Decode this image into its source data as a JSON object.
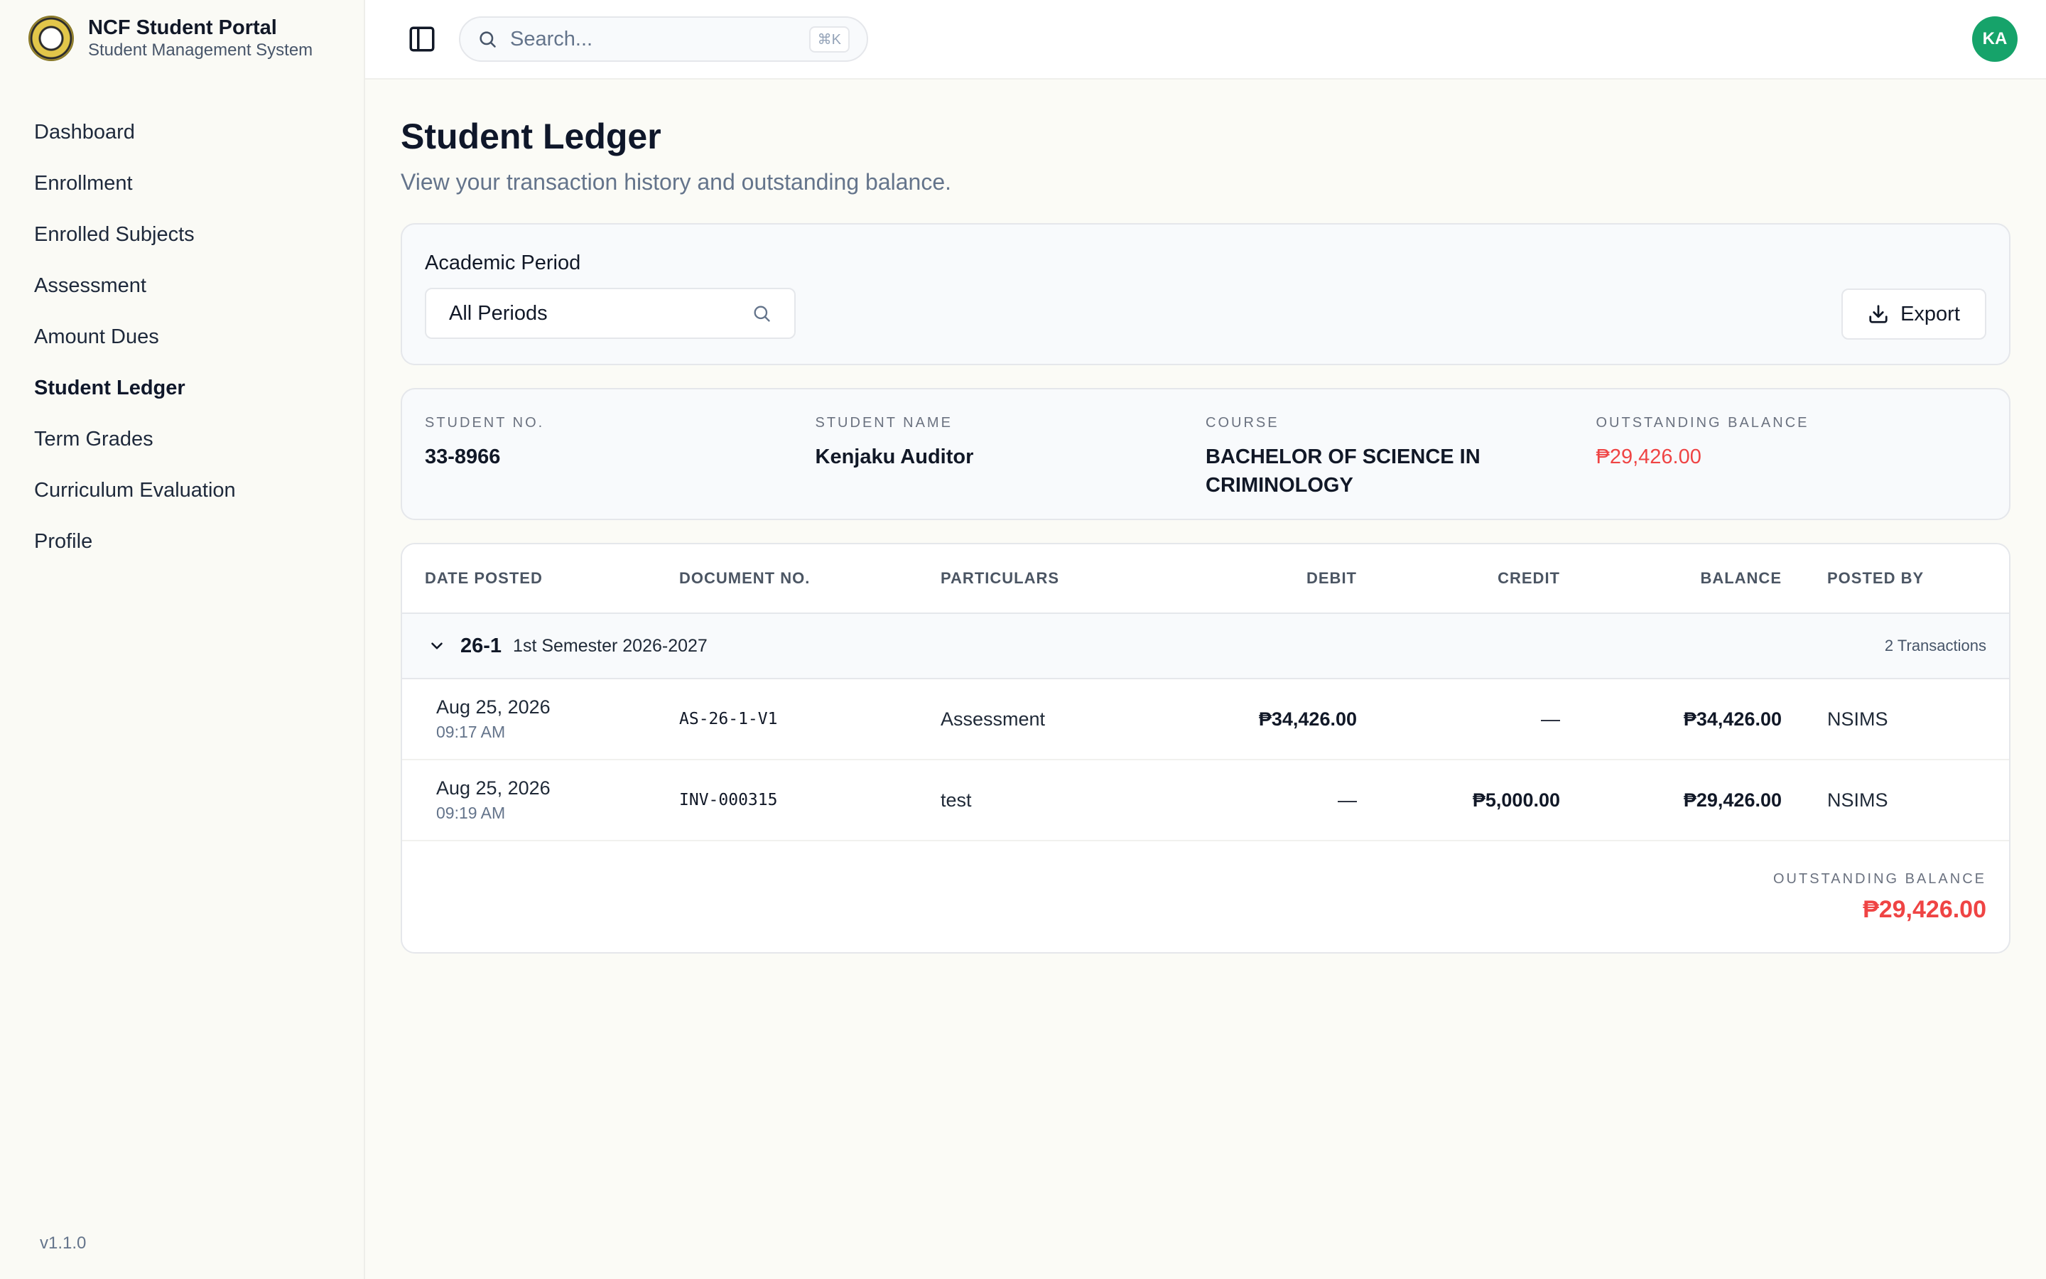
{
  "brand": {
    "title": "NCF Student Portal",
    "subtitle": "Student Management System"
  },
  "sidebar": {
    "items": [
      {
        "label": "Dashboard"
      },
      {
        "label": "Enrollment"
      },
      {
        "label": "Enrolled Subjects"
      },
      {
        "label": "Assessment"
      },
      {
        "label": "Amount Dues"
      },
      {
        "label": "Student Ledger",
        "active": true
      },
      {
        "label": "Term Grades"
      },
      {
        "label": "Curriculum Evaluation"
      },
      {
        "label": "Profile"
      }
    ],
    "version": "v1.1.0"
  },
  "topbar": {
    "search_placeholder": "Search...",
    "shortcut": "⌘K",
    "avatar_initials": "KA",
    "avatar_color": "#16a36a"
  },
  "page": {
    "title": "Student Ledger",
    "subtitle": "View your transaction history and outstanding balance."
  },
  "filter": {
    "label": "Academic Period",
    "selected": "All Periods",
    "export_label": "Export"
  },
  "student": {
    "no_label": "STUDENT NO.",
    "no": "33-8966",
    "name_label": "STUDENT NAME",
    "name": "Kenjaku Auditor",
    "course_label": "COURSE",
    "course": "BACHELOR OF SCIENCE IN CRIMINOLOGY",
    "balance_label": "OUTSTANDING BALANCE",
    "balance": "₱29,426.00"
  },
  "ledger": {
    "columns": [
      "DATE POSTED",
      "DOCUMENT NO.",
      "PARTICULARS",
      "DEBIT",
      "CREDIT",
      "BALANCE",
      "POSTED BY"
    ],
    "group": {
      "code": "26-1",
      "name": "1st Semester 2026-2027",
      "count": "2 Transactions"
    },
    "rows": [
      {
        "date": "Aug 25, 2026",
        "time": "09:17 AM",
        "doc": "AS-26-1-V1",
        "particulars": "Assessment",
        "debit": "₱34,426.00",
        "credit": "—",
        "balance": "₱34,426.00",
        "posted_by": "NSIMS"
      },
      {
        "date": "Aug 25, 2026",
        "time": "09:19 AM",
        "doc": "INV-000315",
        "particulars": "test",
        "debit": "—",
        "credit": "₱5,000.00",
        "balance": "₱29,426.00",
        "posted_by": "NSIMS"
      }
    ],
    "footer_label": "OUTSTANDING BALANCE",
    "footer_value": "₱29,426.00"
  },
  "colors": {
    "accent_red": "#ef4444",
    "avatar_green": "#16a36a"
  }
}
